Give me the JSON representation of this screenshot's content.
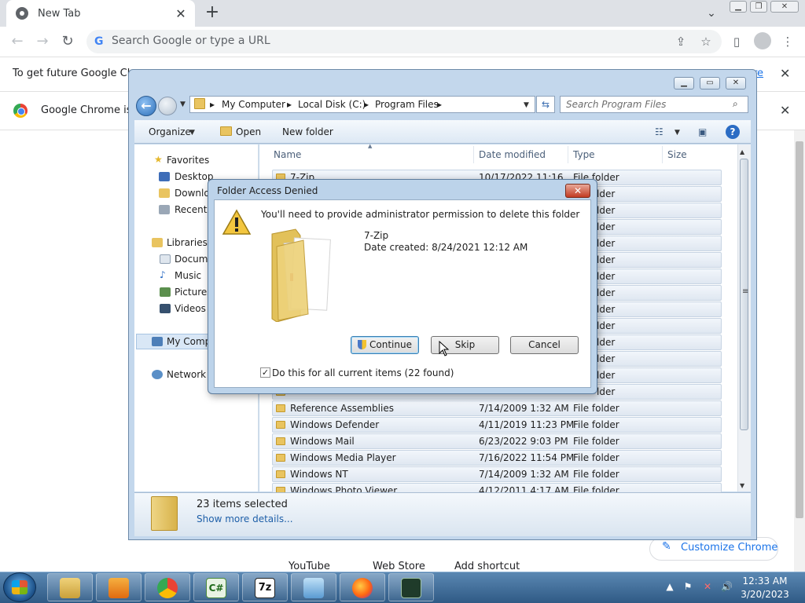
{
  "chrome": {
    "tab_title": "New Tab",
    "tab_close": "✕",
    "new_tab": "+",
    "omnibox_placeholder": "Search Google or type a URL",
    "omnibox_g": "G",
    "infobar_text": "To get future Google Chro",
    "infobar_link": "re",
    "infobar2_text": "Google Chrome isn",
    "close": "✕",
    "shortcuts": [
      "YouTube",
      "Web Store",
      "Add shortcut"
    ],
    "customize": "Customize Chrome"
  },
  "explorer": {
    "address": [
      "My Computer",
      "Local Disk (C:)",
      "Program Files"
    ],
    "search_placeholder": "Search Program Files",
    "toolbar": {
      "organize": "Organize",
      "open": "Open",
      "new_folder": "New folder"
    },
    "nav": {
      "favorites": "Favorites",
      "fav_items": [
        "Desktop",
        "Downlo",
        "Recent P"
      ],
      "libraries": "Libraries",
      "lib_items": [
        "Docume",
        "Music",
        "Pictures",
        "Videos"
      ],
      "computer": "My Comp",
      "network": "Network"
    },
    "columns": {
      "name": "Name",
      "date": "Date modified",
      "type": "Type",
      "size": "Size"
    },
    "partial_rows": [
      {
        "name": "7-Zip",
        "date": "10/17/2022 11:16",
        "type": "File folder"
      }
    ],
    "hidden_type": "lder",
    "rows": [
      {
        "name": "Reference Assemblies",
        "date": "7/14/2009 1:32 AM",
        "type": "File folder"
      },
      {
        "name": "Windows Defender",
        "date": "4/11/2019 11:23 PM",
        "type": "File folder"
      },
      {
        "name": "Windows Mail",
        "date": "6/23/2022 9:03 PM",
        "type": "File folder"
      },
      {
        "name": "Windows Media Player",
        "date": "7/16/2022 11:54 PM",
        "type": "File folder"
      },
      {
        "name": "Windows NT",
        "date": "7/14/2009 1:32 AM",
        "type": "File folder"
      },
      {
        "name": "Windows Photo Viewer",
        "date": "4/12/2011 4:17 AM",
        "type": "File folder"
      }
    ],
    "details": {
      "count": "23 items selected",
      "more": "Show more details..."
    }
  },
  "dialog": {
    "title": "Folder Access Denied",
    "message": "You'll need to provide administrator permission to delete this folder",
    "item_name": "7-Zip",
    "item_date": "Date created: 8/24/2021 12:12 AM",
    "continue": "Continue",
    "skip": "Skip",
    "cancel": "Cancel",
    "checkbox_label": "Do this for all current items (22 found)",
    "checkbox_checked": "✓",
    "close": "✕"
  },
  "taskbar": {
    "time": "12:33 AM",
    "date": "3/20/2023",
    "apps": [
      "file-explorer",
      "media-player",
      "chrome",
      "csharp-editor",
      "7zip",
      "control-panel",
      "firefox",
      "task-manager"
    ],
    "csharp": "C#",
    "sevenzip": "7z"
  }
}
